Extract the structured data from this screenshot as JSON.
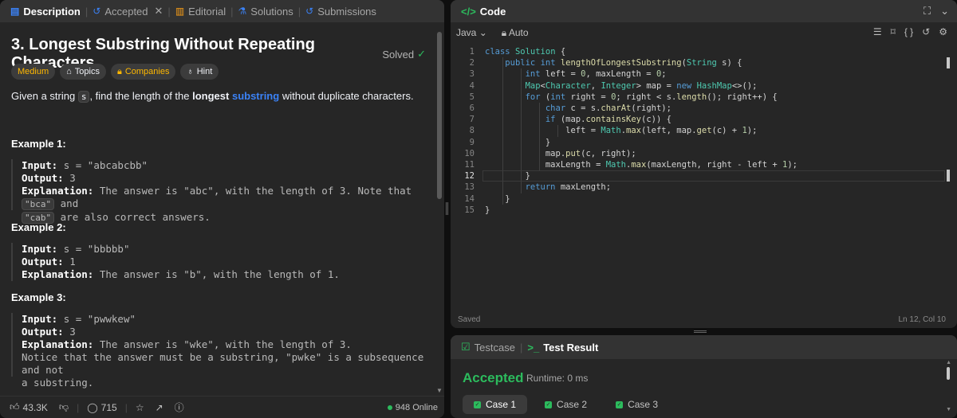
{
  "left_tabs": [
    {
      "icon": "description-icon",
      "label": "Description"
    },
    {
      "icon": "history-icon",
      "label": "Accepted"
    },
    {
      "icon": "book-icon",
      "label": "Editorial"
    },
    {
      "icon": "flask-icon",
      "label": "Solutions"
    },
    {
      "icon": "history-icon",
      "label": "Submissions"
    }
  ],
  "problem": {
    "title": "3. Longest Substring Without Repeating Characters",
    "status": "Solved",
    "chips": [
      "Medium",
      "Topics",
      "Companies",
      "Hint"
    ],
    "lead": {
      "before": "Given a string ",
      "code": "s",
      "middle": ", find the length of the ",
      "bold": "longest",
      "link": "substring",
      "after": " without duplicate characters."
    },
    "examples": [
      {
        "heading": "Example 1:",
        "input_label": "Input:",
        "input": "s = \"abcabcbb\"",
        "output_label": "Output:",
        "output": "3",
        "explanation_label": "Explanation:",
        "explanation": "The answer is \"abc\", with the length of 3. Note that",
        "explanation_code1": "\"bca\"",
        "explanation_mid": "and",
        "explanation_code2": "\"cab\"",
        "explanation_end": "are also correct answers."
      },
      {
        "heading": "Example 2:",
        "input_label": "Input:",
        "input": "s = \"bbbbb\"",
        "output_label": "Output:",
        "output": "1",
        "explanation_label": "Explanation:",
        "explanation": "The answer is \"b\", with the length of 1."
      },
      {
        "heading": "Example 3:",
        "input_label": "Input:",
        "input": "s = \"pwwkew\"",
        "output_label": "Output:",
        "output": "3",
        "explanation_label": "Explanation:",
        "explanation": "The answer is \"wke\", with the length of 3.",
        "note1": "Notice that the answer must be a substring, \"pwke\" is a subsequence and not",
        "note2": "a substring."
      }
    ]
  },
  "footer": {
    "likes": "43.3K",
    "comments": "715",
    "online": "948 Online"
  },
  "code_panel": {
    "title": "Code",
    "language": "Java",
    "mode": "Auto",
    "status": "Saved",
    "cursor": "Ln 12, Col 10",
    "current_line": 12,
    "lines": [
      "class Solution {",
      "    public int lengthOfLongestSubstring(String s) {",
      "        int left = 0, maxLength = 0;",
      "        Map<Character, Integer> map = new HashMap<>();",
      "        for (int right = 0; right < s.length(); right++) {",
      "            char c = s.charAt(right);",
      "            if (map.containsKey(c)) {",
      "                left = Math.max(left, map.get(c) + 1);",
      "            }",
      "            map.put(c, right);",
      "            maxLength = Math.max(maxLength, right - left + 1);",
      "        }",
      "        return maxLength;",
      "    }",
      "}"
    ]
  },
  "result_panel": {
    "tabs": [
      "Testcase",
      "Test Result"
    ],
    "verdict": "Accepted",
    "runtime": "Runtime: 0 ms",
    "cases": [
      "Case 1",
      "Case 2",
      "Case 3"
    ]
  }
}
